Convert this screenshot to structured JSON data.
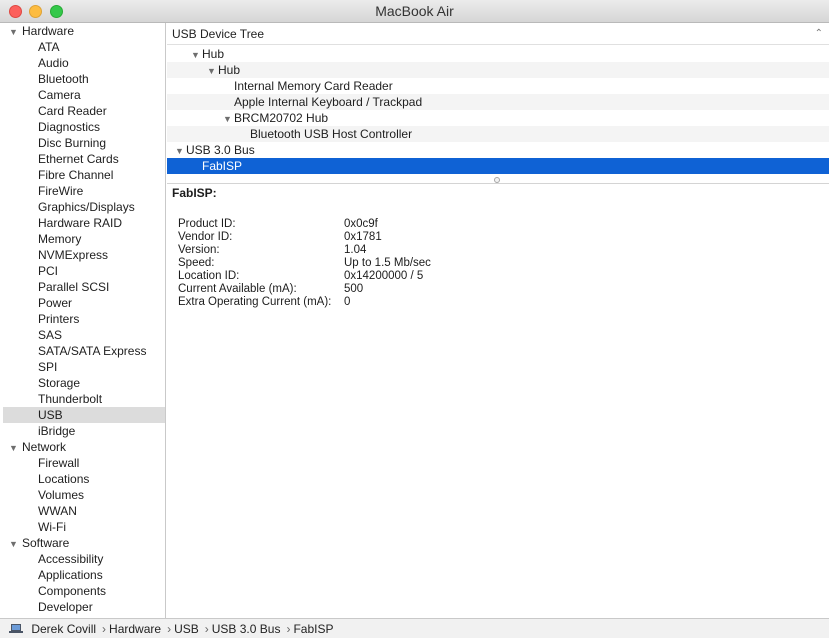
{
  "window": {
    "title": "MacBook Air"
  },
  "sidebar": {
    "categories": [
      {
        "label": "Hardware",
        "items": [
          "ATA",
          "Audio",
          "Bluetooth",
          "Camera",
          "Card Reader",
          "Diagnostics",
          "Disc Burning",
          "Ethernet Cards",
          "Fibre Channel",
          "FireWire",
          "Graphics/Displays",
          "Hardware RAID",
          "Memory",
          "NVMExpress",
          "PCI",
          "Parallel SCSI",
          "Power",
          "Printers",
          "SAS",
          "SATA/SATA Express",
          "SPI",
          "Storage",
          "Thunderbolt",
          "USB",
          "iBridge"
        ]
      },
      {
        "label": "Network",
        "items": [
          "Firewall",
          "Locations",
          "Volumes",
          "WWAN",
          "Wi-Fi"
        ]
      },
      {
        "label": "Software",
        "items": [
          "Accessibility",
          "Applications",
          "Components",
          "Developer"
        ]
      }
    ],
    "selected": "USB"
  },
  "tree": {
    "header": "USB Device Tree",
    "rows": [
      {
        "label": "Hub",
        "level": 1,
        "expanded": true
      },
      {
        "label": "Hub",
        "level": 2,
        "expanded": true
      },
      {
        "label": "Internal Memory Card Reader",
        "level": 3
      },
      {
        "label": "Apple Internal Keyboard / Trackpad",
        "level": 3
      },
      {
        "label": "BRCM20702 Hub",
        "level": 3,
        "expanded": true
      },
      {
        "label": "Bluetooth USB Host Controller",
        "level": 4
      },
      {
        "label": "USB 3.0 Bus",
        "level": 0,
        "expanded": true
      },
      {
        "label": "FabISP",
        "level": 1,
        "selected": true
      }
    ]
  },
  "detail": {
    "title": "FabISP:",
    "properties": [
      {
        "key": "Product ID:",
        "value": "0x0c9f"
      },
      {
        "key": "Vendor ID:",
        "value": "0x1781"
      },
      {
        "key": "Version:",
        "value": "1.04"
      },
      {
        "key": "Speed:",
        "value": "Up to 1.5 Mb/sec"
      },
      {
        "key": "Location ID:",
        "value": "0x14200000 / 5"
      },
      {
        "key": "Current Available (mA):",
        "value": "500"
      },
      {
        "key": "Extra Operating Current (mA):",
        "value": "0"
      }
    ]
  },
  "pathbar": {
    "items": [
      "Derek Covill",
      "Hardware",
      "USB",
      "USB 3.0 Bus",
      "FabISP"
    ]
  },
  "colors": {
    "selection": "#0f62d5",
    "sidebar_selection": "#dcdcdc"
  },
  "icons": {
    "laptop": "laptop-icon",
    "disclosure": "disclosure-triangle-icon"
  }
}
